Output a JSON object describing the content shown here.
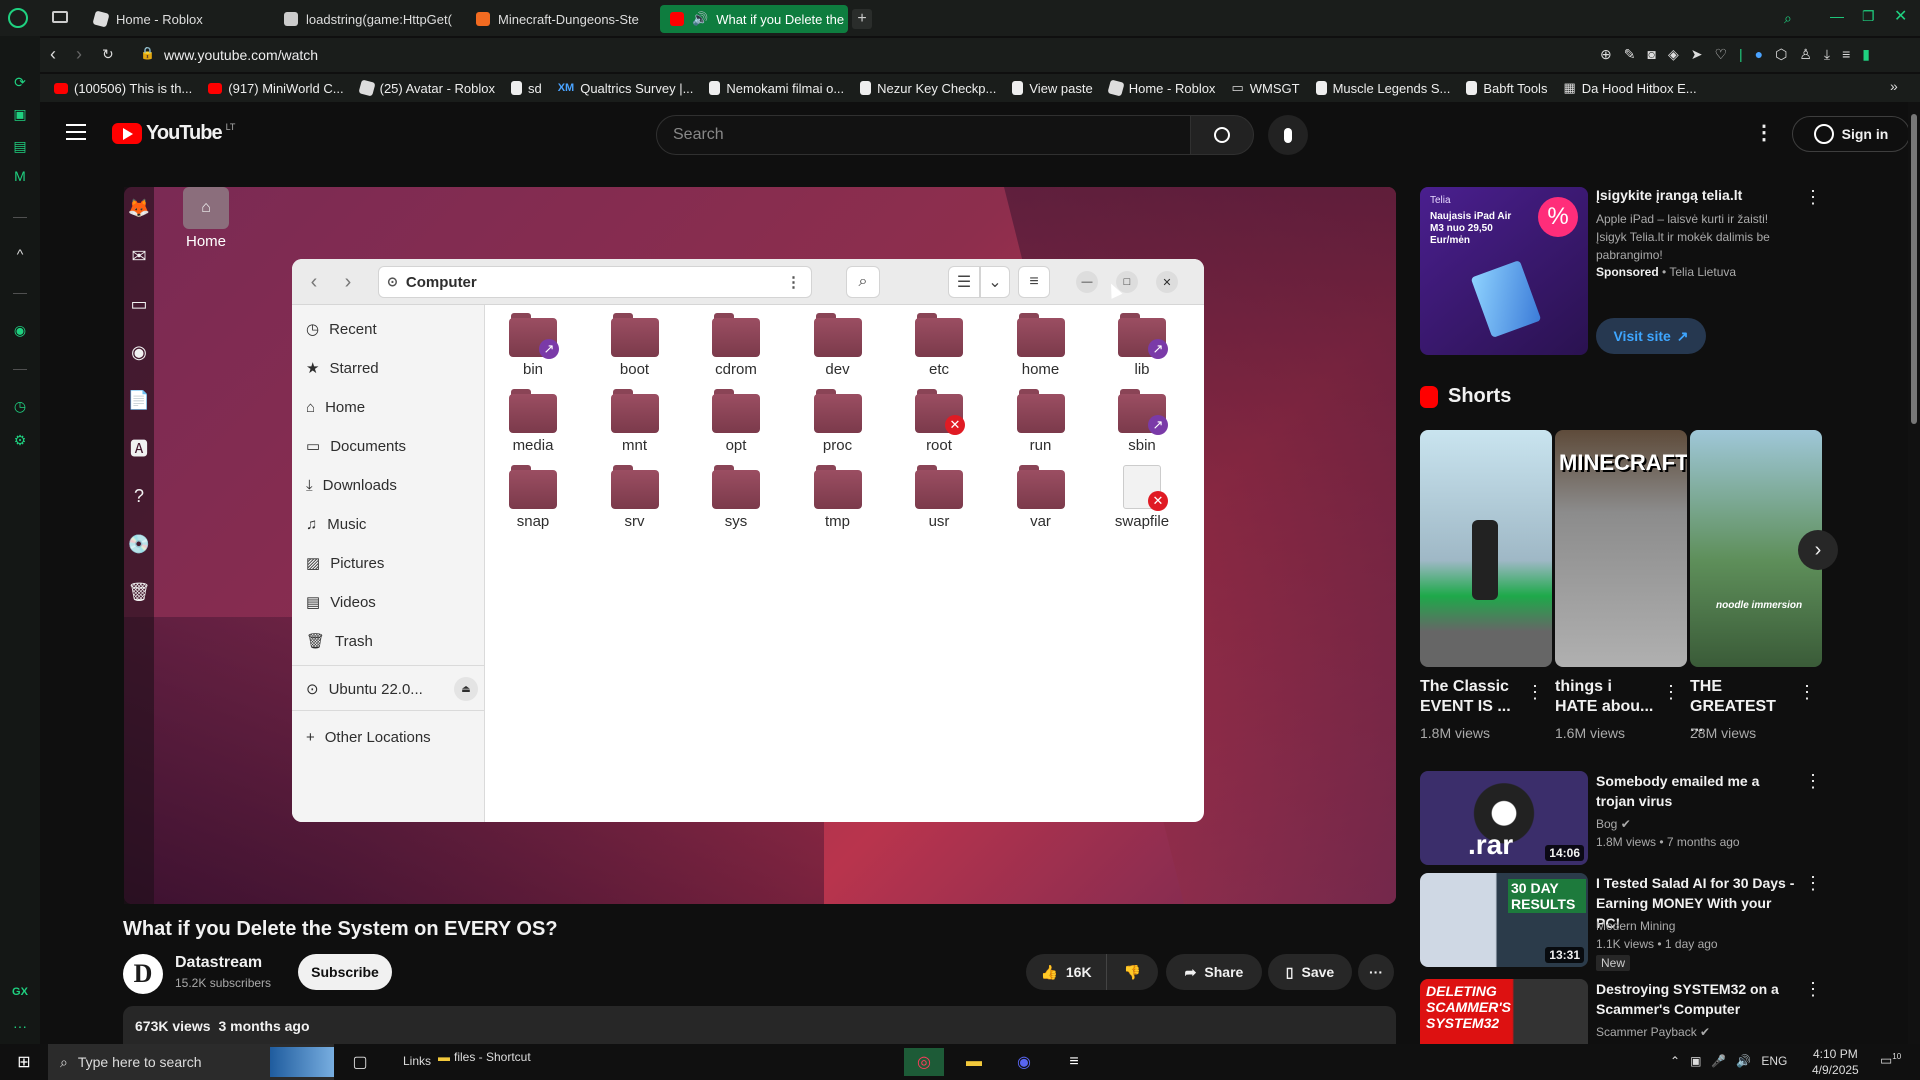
{
  "browser": {
    "tabs": [
      {
        "label": "Home - Roblox",
        "color": "#ffffff"
      },
      {
        "label": "loadstring(game:HttpGet(",
        "color": "#ffffff"
      },
      {
        "label": "Minecraft-Dungeons-Ste",
        "color": "#f26b21"
      },
      {
        "label": "What if you Delete the",
        "color": "#ff0000"
      }
    ],
    "new_tab_icon": "plus-icon",
    "url": "www.youtube.com/watch",
    "bookmarks": [
      {
        "label": "(100506) This is th...",
        "icon": "youtube-icon"
      },
      {
        "label": "(917) MiniWorld C...",
        "icon": "youtube-icon"
      },
      {
        "label": "(25) Avatar - Roblox",
        "icon": "roblox-icon"
      },
      {
        "label": "sd",
        "icon": "page-icon"
      },
      {
        "label": "Qualtrics Survey |...",
        "icon": "qualtrics-icon"
      },
      {
        "label": "Nemokami filmai o...",
        "icon": "page-icon"
      },
      {
        "label": "Nezur Key Checkp...",
        "icon": "page-icon"
      },
      {
        "label": "View paste",
        "icon": "page-icon"
      },
      {
        "label": "Home - Roblox",
        "icon": "roblox-icon"
      },
      {
        "label": "WMSGT",
        "icon": "folder-icon"
      },
      {
        "label": "Muscle Legends S...",
        "icon": "page-icon"
      },
      {
        "label": "Babft Tools",
        "icon": "page-icon"
      },
      {
        "label": "Da Hood Hitbox E...",
        "icon": "page-icon"
      }
    ]
  },
  "youtube": {
    "logo": "YouTube",
    "region": "LT",
    "search_placeholder": "Search",
    "sign_in": "Sign in",
    "video": {
      "title": "What if you Delete the System on EVERY OS?",
      "channel": "Datastream",
      "channel_initial": "D",
      "subscribers": "15.2K subscribers",
      "subscribe": "Subscribe",
      "likes": "16K",
      "share": "Share",
      "save": "Save",
      "views": "673K views",
      "age": "3 months ago"
    },
    "desktop": {
      "home_label": "Home",
      "window_title": "Computer",
      "sidebar": [
        "Recent",
        "Starred",
        "Home",
        "Documents",
        "Downloads",
        "Music",
        "Pictures",
        "Videos",
        "Trash"
      ],
      "drive": "Ubuntu 22.0...",
      "other_locations": "Other Locations",
      "folders": [
        "bin",
        "boot",
        "cdrom",
        "dev",
        "etc",
        "home",
        "lib",
        "media",
        "mnt",
        "opt",
        "proc",
        "root",
        "run",
        "sbin",
        "snap",
        "srv",
        "sys",
        "tmp",
        "usr",
        "var",
        "swapfile"
      ]
    },
    "ad": {
      "title": "Įsigykite įrangą telia.lt",
      "text": "Apple iPad – laisvė kurti ir žaisti! Įsigyk Telia.lt ir mokėk dalimis be pabrangimo!",
      "sponsored": "Sponsored",
      "advertiser": "Telia Lietuva",
      "cta": "Visit site",
      "image_brand": "Telia",
      "image_text": "Naujasis iPad Air M3 nuo 29,50 Eur/mėn"
    },
    "shorts_header": "Shorts",
    "shorts": [
      {
        "title": "The Classic EVENT IS ...",
        "views": "1.8M views"
      },
      {
        "title": "things i HATE abou...",
        "views": "1.6M views",
        "thumb_text": "MINECRAFT"
      },
      {
        "title": "THE GREATEST ...",
        "views": "28M views",
        "thumb_text": "noodle immersion"
      }
    ],
    "recommendations": [
      {
        "title": "Somebody emailed me a trojan virus",
        "channel": "Bog",
        "meta": "1.8M views • 7 months ago",
        "duration": "14:06",
        "thumb_text": ".rar"
      },
      {
        "title": "I Tested Salad AI for 30 Days - Earning MONEY With your PC!",
        "channel": "Modern Mining",
        "meta": "1.1K views • 1 day ago",
        "badge": "New",
        "duration": "13:31",
        "thumb_text": "30 DAY RESULTS"
      },
      {
        "title": "Destroying SYSTEM32 on a Scammer's Computer",
        "channel": "Scammer Payback",
        "thumb_text": "DELETING SCAMMER'S SYSTEM32"
      }
    ]
  },
  "taskbar": {
    "search_placeholder": "Type here to search",
    "links": "Links",
    "files_shortcut": "files - Shortcut",
    "language": "ENG",
    "time": "4:10 PM",
    "date": "4/9/2025",
    "notifications": "10"
  }
}
